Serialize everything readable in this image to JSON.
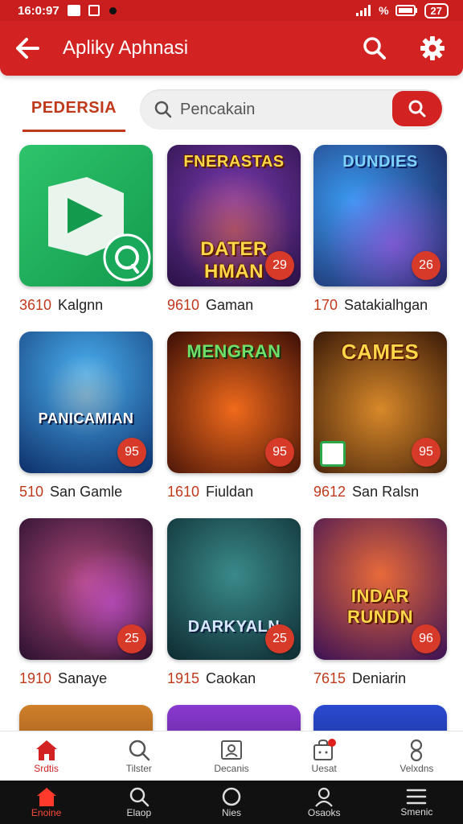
{
  "status": {
    "time": "16:0:97",
    "battery_text": "%",
    "battery_num": "27"
  },
  "appbar": {
    "title": "Apliky Aphnasi"
  },
  "tabs": {
    "active": "PEDERSIA"
  },
  "search": {
    "placeholder": "Pencakain"
  },
  "apps": [
    {
      "num": "3610",
      "name": "Kalgnn",
      "title": "",
      "badge": ""
    },
    {
      "num": "9610",
      "name": "Gaman",
      "title": "DATER HMAN",
      "top": "FNERASTAS",
      "badge": "29"
    },
    {
      "num": "170",
      "name": "Satakialhgan",
      "title": "",
      "top": "DUNDIES",
      "badge": "26"
    },
    {
      "num": "510",
      "name": "San Gamle",
      "title": "PANICAMIAN",
      "badge": "95"
    },
    {
      "num": "1610",
      "name": "Fiuldan",
      "title": "",
      "top": "MENGRAN",
      "badge": "95"
    },
    {
      "num": "9612",
      "name": "San Ralsn",
      "title": "",
      "top": "CAMES",
      "badge": "95"
    },
    {
      "num": "1910",
      "name": "Sanaye",
      "title": "",
      "badge": "25"
    },
    {
      "num": "1915",
      "name": "Caokan",
      "title": "DARKYALN",
      "badge": "25"
    },
    {
      "num": "7615",
      "name": "Deniarin",
      "title": "INDAR RUNDN",
      "badge": "96"
    }
  ],
  "bottom_nav": [
    "Srdtis",
    "Tilster",
    "Decanis",
    "Uesat",
    "Velxdns"
  ],
  "system_nav": [
    "Enoine",
    "Elaop",
    "Nies",
    "Osaoks",
    "Smenic"
  ],
  "colors": {
    "primary": "#d32222",
    "accent": "#c0391b"
  }
}
